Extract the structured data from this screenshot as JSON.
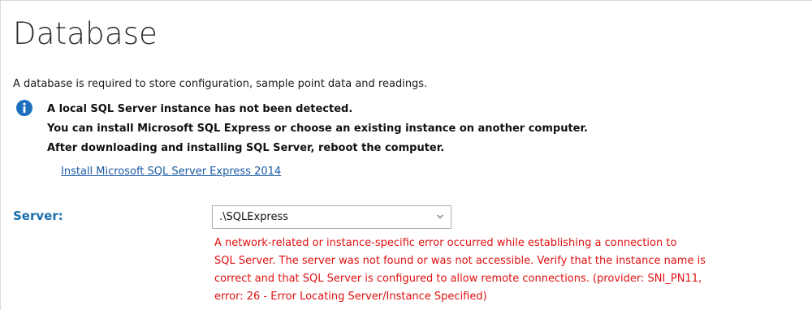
{
  "page": {
    "title": "Database",
    "intro": "A database is required to store configuration, sample point data and readings."
  },
  "info": {
    "icon": "info-icon",
    "lines": [
      "A local SQL Server instance has not been detected.",
      "You can install Microsoft SQL Express or choose an existing instance on another computer.",
      "After downloading and installing SQL Server, reboot the computer."
    ]
  },
  "install_link": "Install Microsoft SQL Server Express 2014",
  "server": {
    "label": "Server:",
    "value": ".\\SQLExpress",
    "dropdown_icon": "chevron-down-icon"
  },
  "error": {
    "lines": [
      "A network-related or instance-specific error occurred while establishing a connection to",
      "SQL Server. The server was not found or was not accessible. Verify that the instance name is",
      "correct and that SQL Server is configured to allow remote connections. (provider: SNI_PN11,",
      "error: 26 - Error Locating Server/Instance Specified)"
    ]
  },
  "colors": {
    "heading": "#2a2a2a",
    "info_icon": "#1f6fbf",
    "link": "#1a5aa6",
    "server_label": "#1a6fae",
    "error": "#e01010"
  }
}
